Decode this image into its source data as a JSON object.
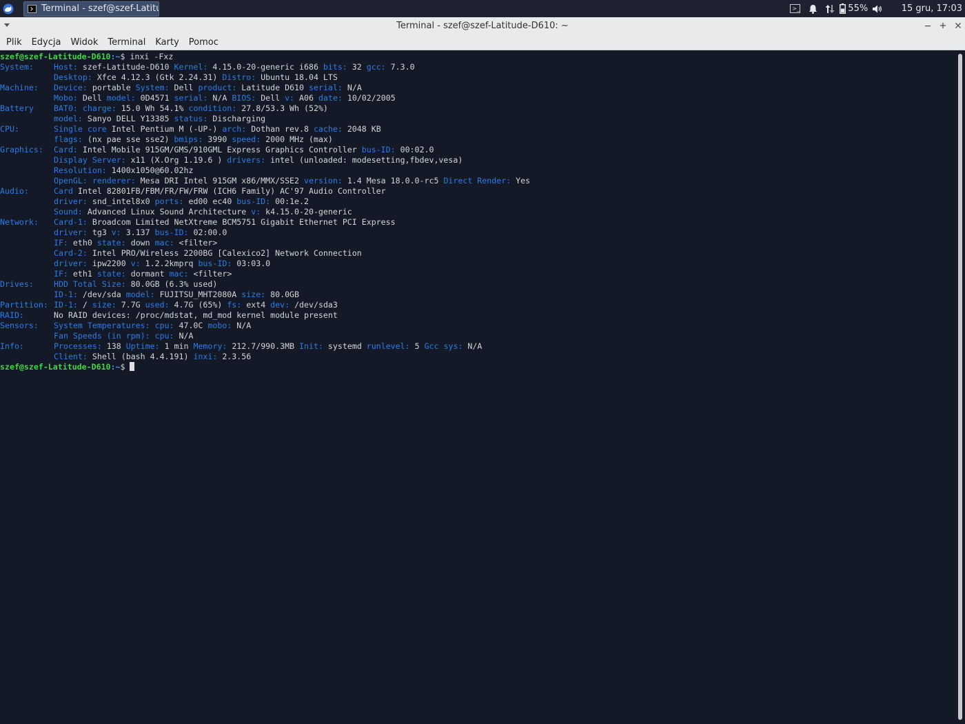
{
  "panel": {
    "task_title": "Terminal - szef@szef-Latitud...",
    "battery_percent": "55%",
    "clock": "15 gru, 17:03"
  },
  "window": {
    "title": "Terminal - szef@szef-Latitude-D610: ~"
  },
  "menu": {
    "items": [
      "Plik",
      "Edycja",
      "Widok",
      "Terminal",
      "Karty",
      "Pomoc"
    ]
  },
  "terminal": {
    "prompt_user": "szef@szef-Latitude-D610",
    "prompt_path": ":~",
    "prompt_symbol": "$ ",
    "command": "inxi -Fxz",
    "rows": [
      {
        "section": "System:",
        "parts": [
          [
            "k",
            "Host:"
          ],
          [
            "v",
            " szef-Latitude-D610 "
          ],
          [
            "k",
            "Kernel:"
          ],
          [
            "v",
            " 4.15.0-20-generic i686 "
          ],
          [
            "k",
            "bits:"
          ],
          [
            "v",
            " 32 "
          ],
          [
            "k",
            "gcc:"
          ],
          [
            "v",
            " 7.3.0"
          ]
        ]
      },
      {
        "section": "",
        "parts": [
          [
            "k",
            "Desktop:"
          ],
          [
            "v",
            " Xfce 4.12.3 (Gtk 2.24.31) "
          ],
          [
            "k",
            "Distro:"
          ],
          [
            "v",
            " Ubuntu 18.04 LTS"
          ]
        ]
      },
      {
        "section": "Machine:",
        "parts": [
          [
            "k",
            "Device:"
          ],
          [
            "v",
            " portable "
          ],
          [
            "k",
            "System:"
          ],
          [
            "v",
            " Dell "
          ],
          [
            "k",
            "product:"
          ],
          [
            "v",
            " Latitude D610 "
          ],
          [
            "k",
            "serial:"
          ],
          [
            "v",
            " N/A"
          ]
        ]
      },
      {
        "section": "",
        "parts": [
          [
            "k",
            "Mobo:"
          ],
          [
            "v",
            " Dell "
          ],
          [
            "k",
            "model:"
          ],
          [
            "v",
            " 0D4571 "
          ],
          [
            "k",
            "serial:"
          ],
          [
            "v",
            " N/A "
          ],
          [
            "k",
            "BIOS:"
          ],
          [
            "v",
            " Dell "
          ],
          [
            "k",
            "v:"
          ],
          [
            "v",
            " A06 "
          ],
          [
            "k",
            "date:"
          ],
          [
            "v",
            " 10/02/2005"
          ]
        ]
      },
      {
        "section": "Battery",
        "parts": [
          [
            "k",
            "BAT0:"
          ],
          [
            "v",
            " "
          ],
          [
            "k",
            "charge:"
          ],
          [
            "v",
            " 15.0 Wh 54.1% "
          ],
          [
            "k",
            "condition:"
          ],
          [
            "v",
            " 27.8/53.3 Wh (52%)"
          ]
        ]
      },
      {
        "section": "",
        "parts": [
          [
            "k",
            "model:"
          ],
          [
            "v",
            " Sanyo DELL Y13385 "
          ],
          [
            "k",
            "status:"
          ],
          [
            "v",
            " Discharging"
          ]
        ]
      },
      {
        "section": "CPU:",
        "parts": [
          [
            "k",
            "Single core"
          ],
          [
            "v",
            " Intel Pentium M (-UP-) "
          ],
          [
            "k",
            "arch:"
          ],
          [
            "v",
            " Dothan rev.8 "
          ],
          [
            "k",
            "cache:"
          ],
          [
            "v",
            " 2048 KB"
          ]
        ]
      },
      {
        "section": "",
        "parts": [
          [
            "k",
            "flags:"
          ],
          [
            "v",
            " (nx pae sse sse2) "
          ],
          [
            "k",
            "bmips:"
          ],
          [
            "v",
            " 3990 "
          ],
          [
            "k",
            "speed:"
          ],
          [
            "v",
            " 2000 MHz (max)"
          ]
        ]
      },
      {
        "section": "Graphics:",
        "parts": [
          [
            "k",
            "Card:"
          ],
          [
            "v",
            " Intel Mobile 915GM/GMS/910GML Express Graphics Controller "
          ],
          [
            "k",
            "bus-ID:"
          ],
          [
            "v",
            " 00:02.0"
          ]
        ]
      },
      {
        "section": "",
        "parts": [
          [
            "k",
            "Display Server:"
          ],
          [
            "v",
            " x11 (X.Org 1.19.6 ) "
          ],
          [
            "k",
            "drivers:"
          ],
          [
            "v",
            " intel (unloaded: modesetting,fbdev,vesa)"
          ]
        ]
      },
      {
        "section": "",
        "parts": [
          [
            "k",
            "Resolution:"
          ],
          [
            "v",
            " 1400x1050@60.02hz"
          ]
        ]
      },
      {
        "section": "",
        "parts": [
          [
            "k",
            "OpenGL:"
          ],
          [
            "v",
            " "
          ],
          [
            "k",
            "renderer:"
          ],
          [
            "v",
            " Mesa DRI Intel 915GM x86/MMX/SSE2 "
          ],
          [
            "k",
            "version:"
          ],
          [
            "v",
            " 1.4 Mesa 18.0.0-rc5 "
          ],
          [
            "k",
            "Direct Render:"
          ],
          [
            "v",
            " Yes"
          ]
        ]
      },
      {
        "section": "Audio:",
        "parts": [
          [
            "k",
            "Card"
          ],
          [
            "v",
            " Intel 82801FB/FBM/FR/FW/FRW (ICH6 Family) AC'97 Audio Controller"
          ]
        ]
      },
      {
        "section": "",
        "parts": [
          [
            "k",
            "driver:"
          ],
          [
            "v",
            " snd_intel8x0 "
          ],
          [
            "k",
            "ports:"
          ],
          [
            "v",
            " ed00 ec40 "
          ],
          [
            "k",
            "bus-ID:"
          ],
          [
            "v",
            " 00:1e.2"
          ]
        ]
      },
      {
        "section": "",
        "parts": [
          [
            "k",
            "Sound:"
          ],
          [
            "v",
            " Advanced Linux Sound Architecture "
          ],
          [
            "k",
            "v:"
          ],
          [
            "v",
            " k4.15.0-20-generic"
          ]
        ]
      },
      {
        "section": "Network:",
        "parts": [
          [
            "k",
            "Card-1:"
          ],
          [
            "v",
            " Broadcom Limited NetXtreme BCM5751 Gigabit Ethernet PCI Express"
          ]
        ]
      },
      {
        "section": "",
        "parts": [
          [
            "k",
            "driver:"
          ],
          [
            "v",
            " tg3 "
          ],
          [
            "k",
            "v:"
          ],
          [
            "v",
            " 3.137 "
          ],
          [
            "k",
            "bus-ID:"
          ],
          [
            "v",
            " 02:00.0"
          ]
        ]
      },
      {
        "section": "",
        "parts": [
          [
            "k",
            "IF:"
          ],
          [
            "v",
            " eth0 "
          ],
          [
            "k",
            "state:"
          ],
          [
            "v",
            " down "
          ],
          [
            "k",
            "mac:"
          ],
          [
            "v",
            " <filter>"
          ]
        ]
      },
      {
        "section": "",
        "parts": [
          [
            "k",
            "Card-2:"
          ],
          [
            "v",
            " Intel PRO/Wireless 2200BG [Calexico2] Network Connection"
          ]
        ]
      },
      {
        "section": "",
        "parts": [
          [
            "k",
            "driver:"
          ],
          [
            "v",
            " ipw2200 "
          ],
          [
            "k",
            "v:"
          ],
          [
            "v",
            " 1.2.2kmprq "
          ],
          [
            "k",
            "bus-ID:"
          ],
          [
            "v",
            " 03:03.0"
          ]
        ]
      },
      {
        "section": "",
        "parts": [
          [
            "k",
            "IF:"
          ],
          [
            "v",
            " eth1 "
          ],
          [
            "k",
            "state:"
          ],
          [
            "v",
            " dormant "
          ],
          [
            "k",
            "mac:"
          ],
          [
            "v",
            " <filter>"
          ]
        ]
      },
      {
        "section": "Drives:",
        "parts": [
          [
            "k",
            "HDD Total Size:"
          ],
          [
            "v",
            " 80.0GB (6.3% used)"
          ]
        ]
      },
      {
        "section": "",
        "parts": [
          [
            "k",
            "ID-1:"
          ],
          [
            "v",
            " /dev/sda "
          ],
          [
            "k",
            "model:"
          ],
          [
            "v",
            " FUJITSU_MHT2080A "
          ],
          [
            "k",
            "size:"
          ],
          [
            "v",
            " 80.0GB"
          ]
        ]
      },
      {
        "section": "Partition:",
        "parts": [
          [
            "k",
            "ID-1:"
          ],
          [
            "v",
            " / "
          ],
          [
            "k",
            "size:"
          ],
          [
            "v",
            " 7.7G "
          ],
          [
            "k",
            "used:"
          ],
          [
            "v",
            " 4.7G (65%) "
          ],
          [
            "k",
            "fs:"
          ],
          [
            "v",
            " ext4 "
          ],
          [
            "k",
            "dev:"
          ],
          [
            "v",
            " /dev/sda3"
          ]
        ]
      },
      {
        "section": "RAID:",
        "parts": [
          [
            "v",
            "No RAID devices: /proc/mdstat, md_mod kernel module present"
          ]
        ]
      },
      {
        "section": "Sensors:",
        "parts": [
          [
            "k",
            "System Temperatures:"
          ],
          [
            "v",
            " "
          ],
          [
            "k",
            "cpu:"
          ],
          [
            "v",
            " 47.0C "
          ],
          [
            "k",
            "mobo:"
          ],
          [
            "v",
            " N/A"
          ]
        ]
      },
      {
        "section": "",
        "parts": [
          [
            "k",
            "Fan Speeds (in rpm):"
          ],
          [
            "v",
            " "
          ],
          [
            "k",
            "cpu:"
          ],
          [
            "v",
            " N/A"
          ]
        ]
      },
      {
        "section": "Info:",
        "parts": [
          [
            "k",
            "Processes:"
          ],
          [
            "v",
            " 138 "
          ],
          [
            "k",
            "Uptime:"
          ],
          [
            "v",
            " 1 min "
          ],
          [
            "k",
            "Memory:"
          ],
          [
            "v",
            " 212.7/990.3MB "
          ],
          [
            "k",
            "Init:"
          ],
          [
            "v",
            " systemd "
          ],
          [
            "k",
            "runlevel:"
          ],
          [
            "v",
            " 5 "
          ],
          [
            "k",
            "Gcc sys:"
          ],
          [
            "v",
            " N/A"
          ]
        ]
      },
      {
        "section": "",
        "parts": [
          [
            "k",
            "Client:"
          ],
          [
            "v",
            " Shell (bash 4.4.191) "
          ],
          [
            "k",
            "inxi:"
          ],
          [
            "v",
            " 2.3.56"
          ]
        ]
      }
    ]
  }
}
